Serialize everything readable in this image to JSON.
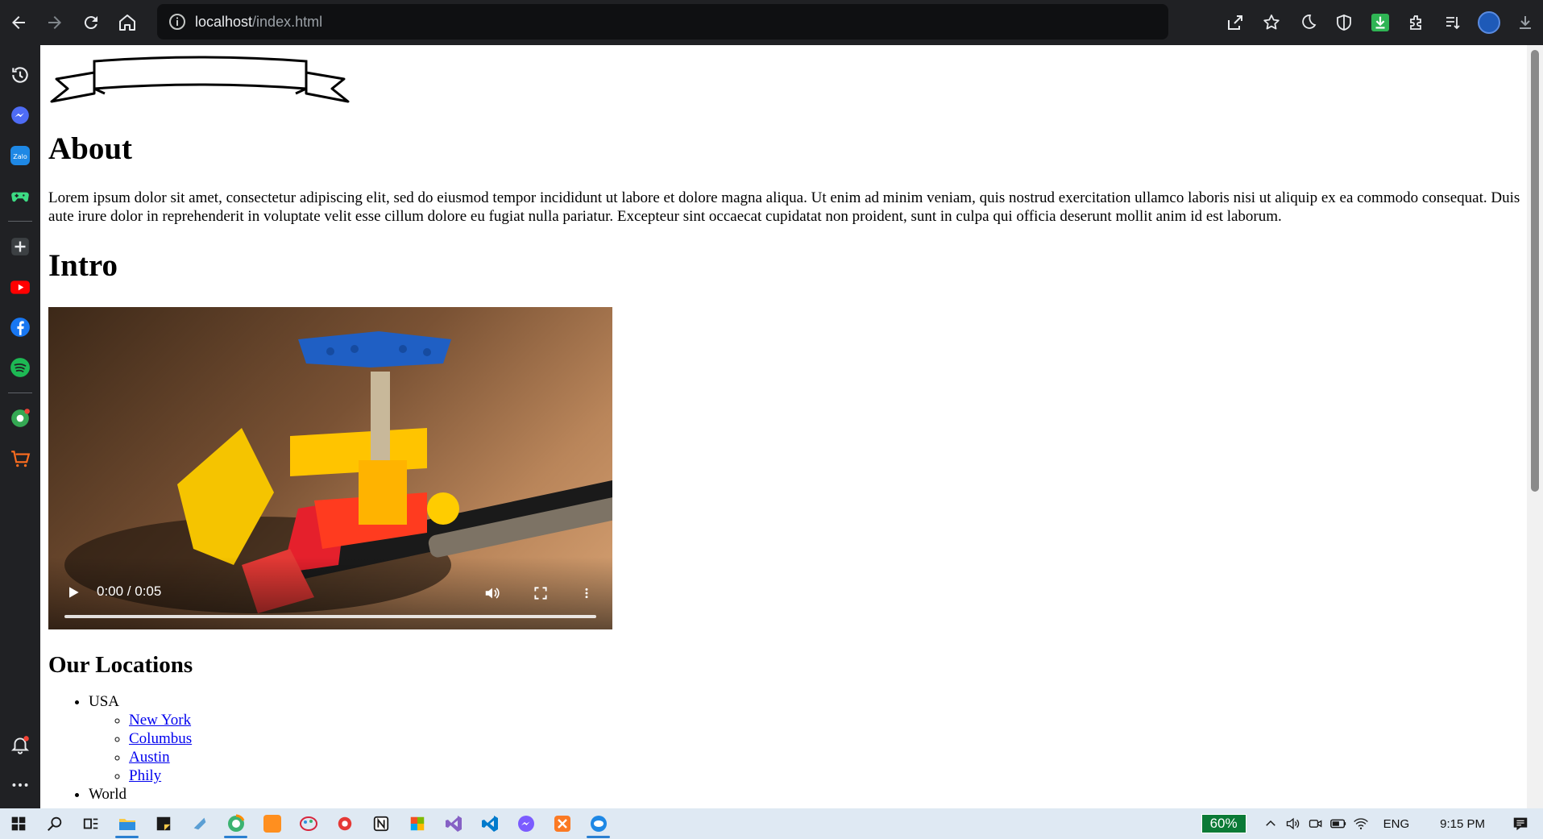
{
  "browser": {
    "url_host": "localhost",
    "url_path": "/index.html",
    "icons": {
      "back": "arrow-left-icon",
      "forward": "arrow-right-icon",
      "reload": "reload-icon",
      "home": "home-icon",
      "site_info": "info-icon",
      "share": "share-icon",
      "bookmark": "star-icon",
      "theme": "moon-icon",
      "shield": "shield-icon",
      "download_ext": "download-extension-icon",
      "extensions": "puzzle-icon",
      "reading_list": "reading-list-icon",
      "profile": "profile-avatar",
      "downloads": "download-icon"
    }
  },
  "sidebar": {
    "items": [
      {
        "name": "history-icon"
      },
      {
        "name": "messenger-icon"
      },
      {
        "name": "zalo-icon",
        "text": "Zalo"
      },
      {
        "name": "games-icon"
      },
      {
        "name": "add-icon"
      },
      {
        "name": "youtube-icon"
      },
      {
        "name": "facebook-icon"
      },
      {
        "name": "spotify-icon"
      },
      {
        "name": "soccer-icon"
      },
      {
        "name": "shopping-icon"
      }
    ],
    "bottom": [
      {
        "name": "notifications-icon"
      },
      {
        "name": "more-icon"
      }
    ]
  },
  "page": {
    "about_heading": "About",
    "about_text": "Lorem ipsum dolor sit amet, consectetur adipiscing elit, sed do eiusmod tempor incididunt ut labore et dolore magna aliqua. Ut enim ad minim veniam, quis nostrud exercitation ullamco laboris nisi ut aliquip ex ea commodo consequat. Duis aute irure dolor in reprehenderit in voluptate velit esse cillum dolore eu fugiat nulla pariatur. Excepteur sint occaecat cupidatat non proident, sunt in culpa qui officia deserunt mollit anim id est laborum.",
    "intro_heading": "Intro",
    "video": {
      "time": "0:00 / 0:05",
      "progress": 0
    },
    "locations_heading": "Our Locations",
    "locations": [
      {
        "country": "USA",
        "cities": [
          "New York",
          "Columbus",
          "Austin",
          "Phily"
        ]
      },
      {
        "country": "World",
        "cities": []
      }
    ]
  },
  "taskbar": {
    "apps": [
      {
        "name": "start-icon"
      },
      {
        "name": "search-icon"
      },
      {
        "name": "task-view-icon"
      },
      {
        "name": "file-explorer-icon",
        "active": true
      },
      {
        "name": "sticky-notes-icon"
      },
      {
        "name": "app-icon"
      },
      {
        "name": "coccoc-browser-icon",
        "active": true
      },
      {
        "name": "app-orange-icon"
      },
      {
        "name": "paint-icon"
      },
      {
        "name": "app-red-icon"
      },
      {
        "name": "notion-icon"
      },
      {
        "name": "office-icon"
      },
      {
        "name": "visual-studio-icon"
      },
      {
        "name": "vscode-icon"
      },
      {
        "name": "messenger-icon"
      },
      {
        "name": "xampp-icon"
      },
      {
        "name": "zalo-icon",
        "active": true
      }
    ],
    "battery_percent": "60%",
    "language": "ENG",
    "time": "9:15 PM"
  },
  "colors": {
    "chrome_dark": "#202124",
    "link": "#0000ee",
    "taskbar_bg": "#dfe9f3",
    "battery_green": "#0b7a36"
  }
}
